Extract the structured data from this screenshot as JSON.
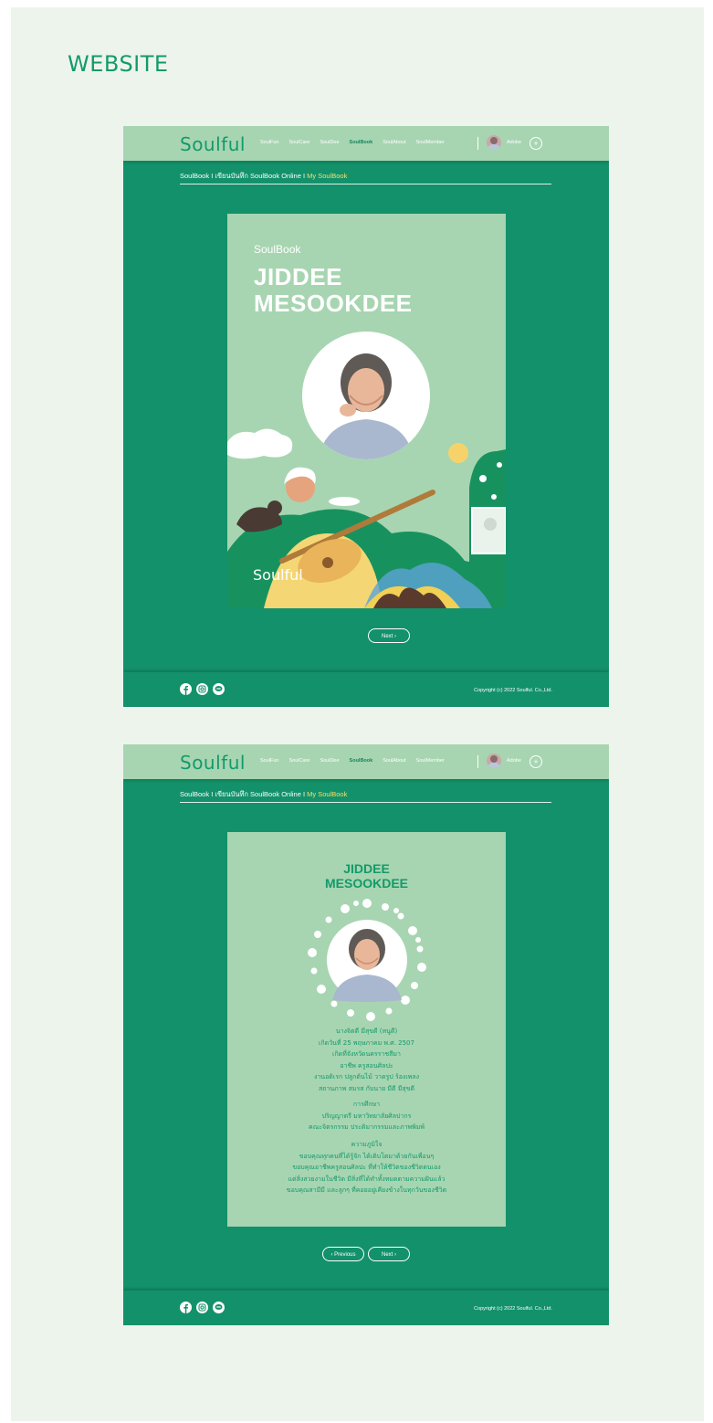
{
  "page_heading": "WEBSITE",
  "site": {
    "logo": "Soulful",
    "nav": [
      "SoulFun",
      "SoulCare",
      "SoulDee",
      "SoulBook",
      "SoulAbout",
      "SoulMember"
    ],
    "nav_active": "SoulBook",
    "user_name": "Adobe",
    "plus_symbol": "+",
    "breadcrumb_prefix": "SoulBook I เขียนบันทึก SoulBook Online I ",
    "breadcrumb_current": "My SoulBook",
    "copyright": "Copyright (c) 2022 Soulful. Co.,Ltd.",
    "social_icons": [
      "facebook-icon",
      "instagram-icon",
      "line-icon"
    ]
  },
  "cover": {
    "kicker": "SoulBook",
    "title_line1": "JIDDEE",
    "title_line2": "MESOOKDEE",
    "illustration_logo": "Soulful",
    "next_label": "Next ›"
  },
  "info": {
    "title_line1": "JIDDEE",
    "title_line2": "MESOOKDEE",
    "bio": [
      "นางจิตดี มีสุขดี (หนูดี)",
      "เกิดวันที่ 25 พฤษภาคม พ.ศ. 2507",
      "เกิดที่จังหวัดนครราชสีมา",
      "อาชีพ ครูสอนศิลปะ",
      "งานอดิเรก ปลูกต้นไม้ วาดรูป ร้องเพลง",
      "สถานภาพ สมรส กับนาย มีดี มีสุขดี"
    ],
    "education_heading": "การศึกษา",
    "education": [
      "ปริญญาตรี มหาวิทยาลัยศิลปากร",
      "คณะจิตรกรรม ประติมากรรมและภาพพิมพ์"
    ],
    "pride_heading": "ความภูมิใจ",
    "pride": [
      "ขอบคุณทุกคนที่ได้รู้จัก ได้เติบโตมาด้วยกันเพื่อนๆ",
      "ขอบคุณอาชีพครูสอนศิลปะ ที่ทำให้ชีวิตของชีวิตตนเอง",
      "แต่สิ่งสวยงามในชีวิต มีสิ่งที่ได้ทำทั้งหมดตามความฝันแล้ว",
      "ขอบคุณสามีมี และลูกๆ ที่คอยอยู่เคียงข้างในทุกวันของชีวิต"
    ],
    "previous_label": "‹ Previous",
    "next_label": "Next ›"
  },
  "colors": {
    "brand_green": "#13916a",
    "light_green": "#a7d5b1",
    "canvas": "#edf4ec",
    "highlight_yellow": "#f5e06a"
  }
}
